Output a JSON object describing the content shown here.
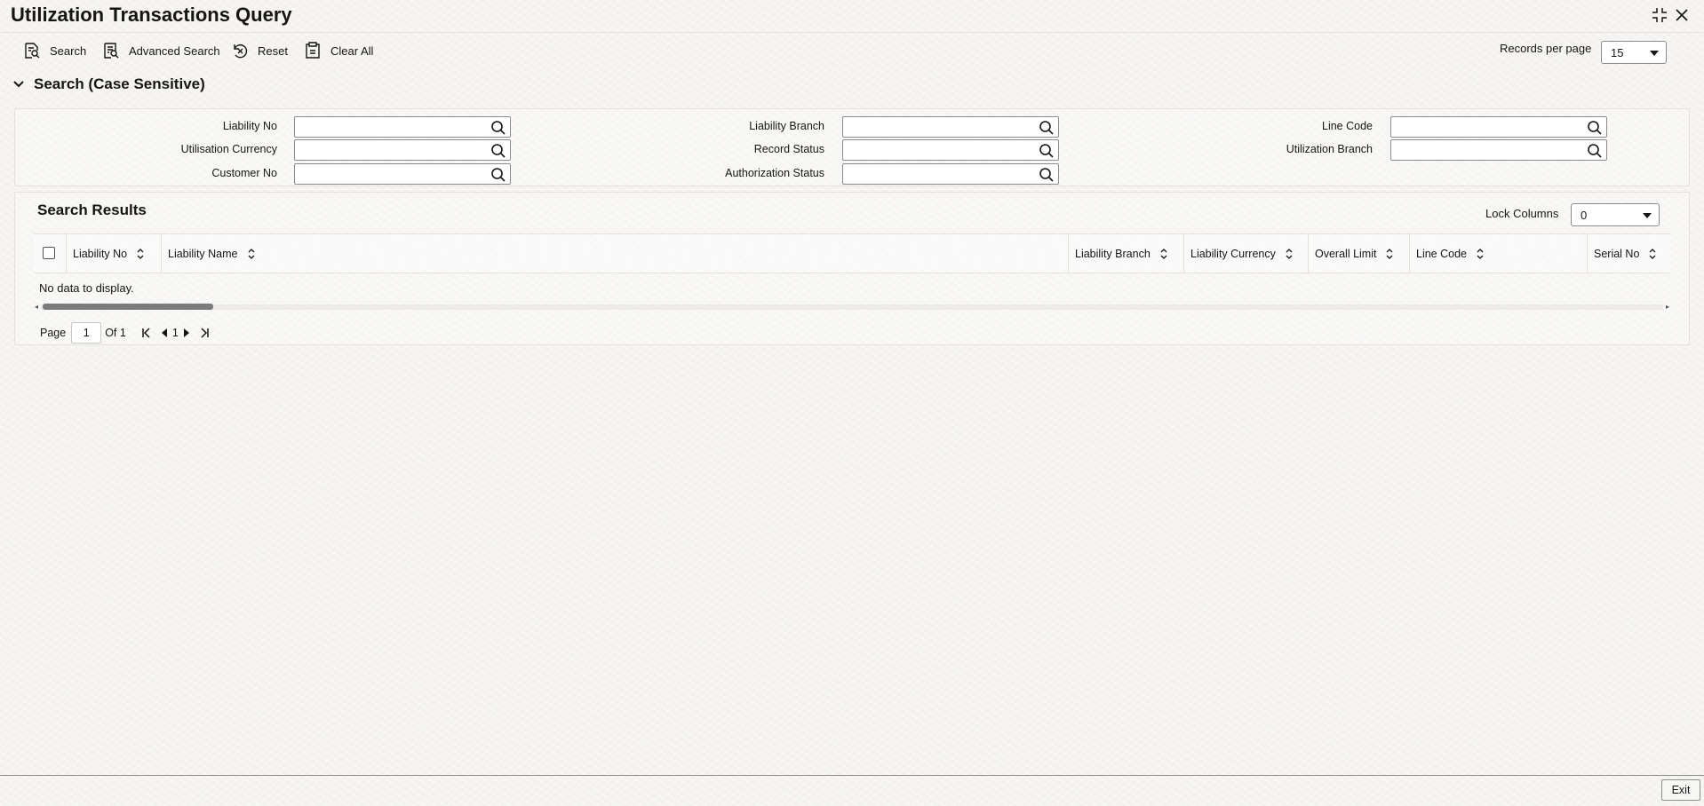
{
  "window": {
    "title": "Utilization Transactions Query"
  },
  "toolbar": {
    "search": "Search",
    "advanced_search": "Advanced Search",
    "reset": "Reset",
    "clear_all": "Clear All",
    "records_per_page_label": "Records per page",
    "records_per_page_value": "15"
  },
  "search_section": {
    "title": "Search (Case Sensitive)",
    "fields": {
      "liability_no": "Liability No",
      "utilisation_currency": "Utilisation Currency",
      "customer_no": "Customer No",
      "liability_branch": "Liability Branch",
      "record_status": "Record Status",
      "authorization_status": "Authorization Status",
      "line_code": "Line Code",
      "utilization_branch": "Utilization Branch"
    }
  },
  "results": {
    "title": "Search Results",
    "lock_columns_label": "Lock Columns",
    "lock_columns_value": "0",
    "columns": [
      "Liability No",
      "Liability Name",
      "Liability Branch",
      "Liability Currency",
      "Overall Limit",
      "Line Code",
      "Serial No"
    ],
    "empty_message": "No data to display."
  },
  "pagination": {
    "page_label": "Page",
    "current_page": "1",
    "of_label": "Of 1",
    "page_number": "1"
  },
  "footer": {
    "exit": "Exit"
  },
  "icons": [
    "search-doc-icon",
    "advanced-search-icon",
    "reset-icon",
    "clear-all-icon",
    "chevron-down-icon",
    "magnifier-icon",
    "sort-icon",
    "minimize-icon",
    "close-icon",
    "first-page-icon",
    "prev-page-icon",
    "next-page-icon",
    "last-page-icon"
  ]
}
